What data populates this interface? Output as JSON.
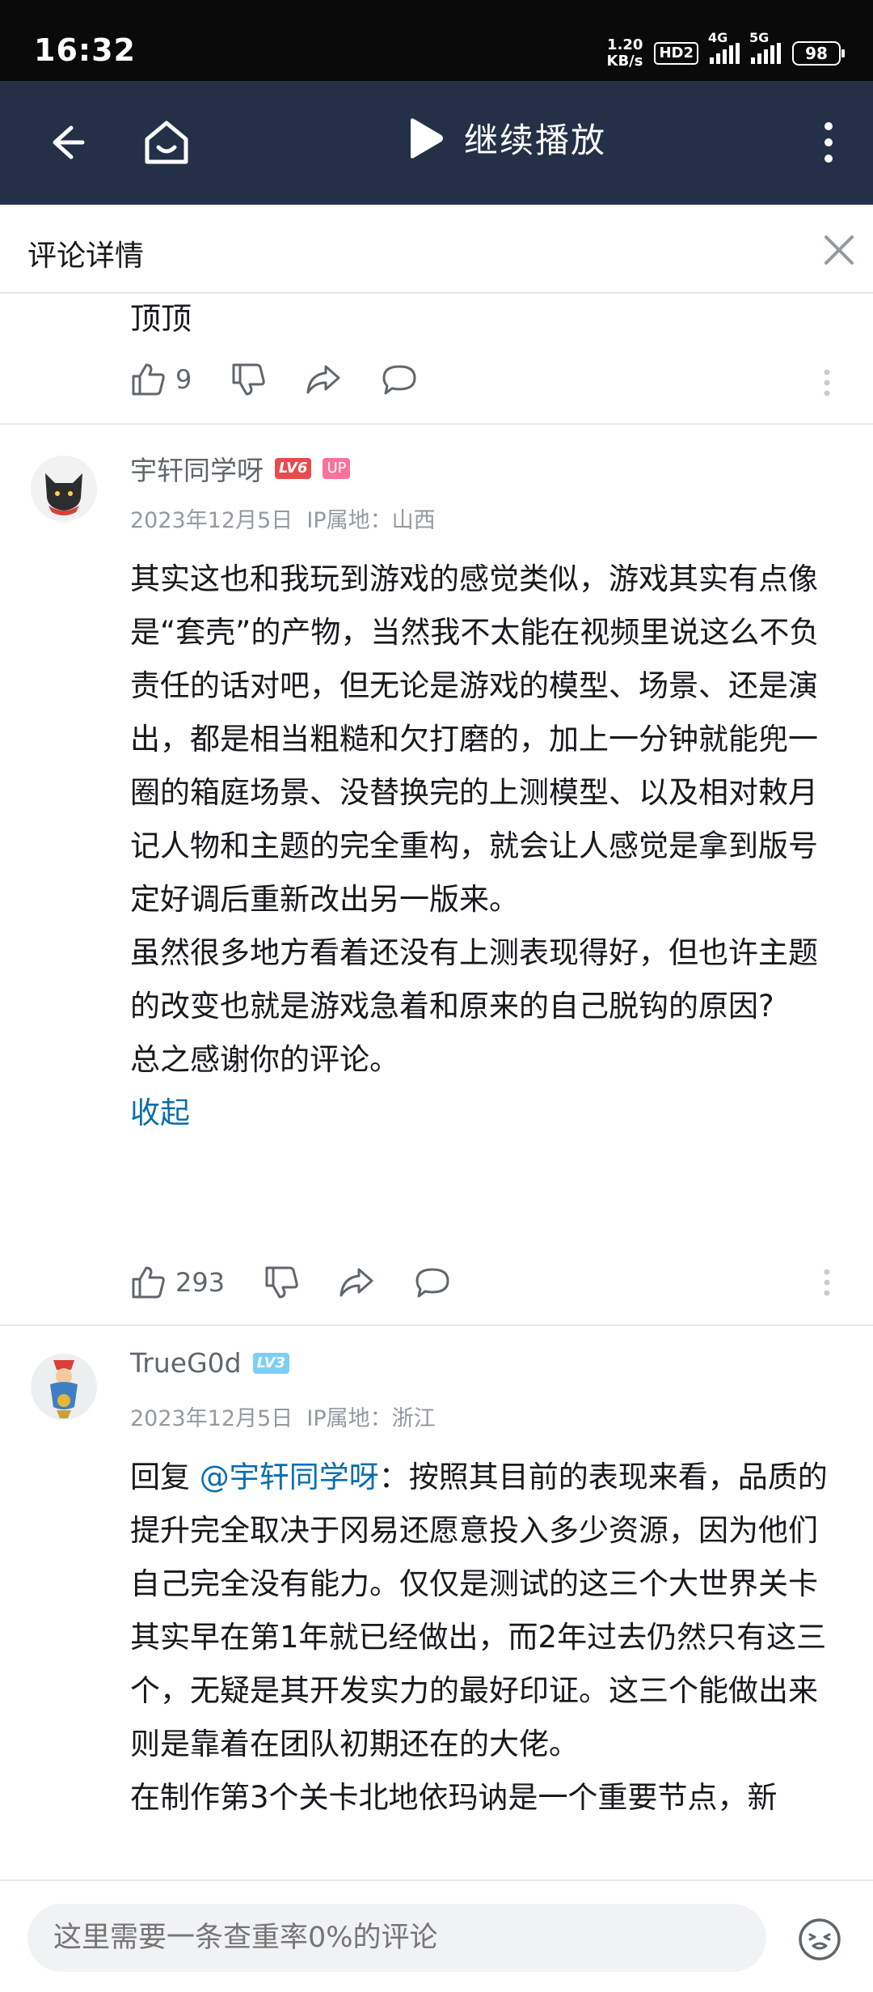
{
  "status_bar": {
    "time": "16:32",
    "net_speed_value": "1.20",
    "net_speed_unit": "KB/s",
    "hd_label": "HD2",
    "sig1_label": "4G",
    "sig2_label": "5G",
    "battery": "98"
  },
  "video_bar": {
    "resume_label": "继续播放"
  },
  "title_bar": {
    "title": "评论详情"
  },
  "comments": [
    {
      "text": "顶顶",
      "likes": "9"
    },
    {
      "username": "宇轩同学呀",
      "level": "LV6",
      "up_tag": "UP",
      "date": "2023年12月5日",
      "ip": "IP属地：山西",
      "paragraphs": [
        "其实这也和我玩到游戏的感觉类似，游戏其实有点像是“套壳”的产物，当然我不太能在视频里说这么不负责任的话对吧，但无论是游戏的模型、场景、还是演出，都是相当粗糙和欠打磨的，加上一分钟就能兜一圈的箱庭场景、没替换完的上测模型、以及相对敕月记人物和主题的完全重构，就会让人感觉是拿到版号定好调后重新改出另一版来。",
        "虽然很多地方看着还没有上测表现得好，但也许主题的改变也就是游戏急着和原来的自己脱钩的原因?",
        "总之感谢你的评论。"
      ],
      "collapse_label": "收起",
      "likes": "293"
    },
    {
      "username": "TrueG0d",
      "level": "LV3",
      "date": "2023年12月5日",
      "ip": "IP属地：浙江",
      "reply_prefix": "回复 ",
      "mention": "@宇轩同学呀",
      "reply_text": "：按照其目前的表现来看，品质的提升完全取决于冈易还愿意投入多少资源，因为他们自己完全没有能力。仅仅是测试的这三个大世界关卡其实早在第1年就已经做出，而2年过去仍然只有这三个，无疑是其开发实力的最好印证。这三个能做出来则是靠着在团队初期还在的大佬。",
      "reply_text_2": "在制作第3个关卡北地依玛讷是一个重要节点，新"
    }
  ],
  "bottom_bar": {
    "input_placeholder": "这里需要一条查重率0%的评论"
  },
  "colors": {
    "video_bar_bg": "#233048",
    "link_blue": "#0a6fae",
    "up_pink": "#fb7299",
    "lv6_red": "#e84b4b",
    "lv3_blue": "#7bd0f4"
  }
}
